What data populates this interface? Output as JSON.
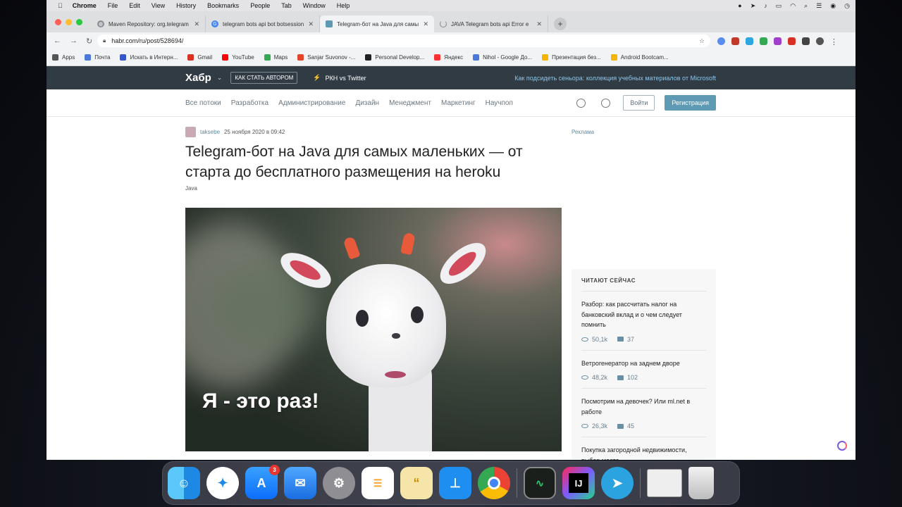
{
  "menubar": {
    "apple": "",
    "app": "Chrome",
    "items": [
      "File",
      "Edit",
      "View",
      "History",
      "Bookmarks",
      "People",
      "Tab",
      "Window",
      "Help"
    ]
  },
  "tabs": [
    {
      "title": "Maven Repository: org.telegram",
      "icon": "globe-icon"
    },
    {
      "title": "telegram bots api bot botsession",
      "icon": "google-icon"
    },
    {
      "title": "Telegram-бот на Java для самых",
      "icon": "habr-icon",
      "active": true
    },
    {
      "title": "JAVA Telegram bots api Error e",
      "icon": "loading-icon"
    }
  ],
  "toolbar": {
    "url": "habr.com/ru/post/528694/"
  },
  "bookmarks": [
    {
      "label": "Apps",
      "color": "#555"
    },
    {
      "label": "Почта",
      "color": "#4a79d9"
    },
    {
      "label": "Искать в Интерн...",
      "color": "#3558c9"
    },
    {
      "label": "Gmail",
      "color": "#d93025"
    },
    {
      "label": "YouTube",
      "color": "#ff0000"
    },
    {
      "label": "Maps",
      "color": "#34a853"
    },
    {
      "label": "Sanjar Suvonov -...",
      "color": "#e2432a"
    },
    {
      "label": "Personal Develop...",
      "color": "#222"
    },
    {
      "label": "Яндекс",
      "color": "#ff3333"
    },
    {
      "label": "Nihol - Google До...",
      "color": "#4a79d9"
    },
    {
      "label": "Презентация без...",
      "color": "#f4b400"
    },
    {
      "label": "Android Bootcam...",
      "color": "#f4b400"
    }
  ],
  "habr": {
    "logo": "Хабр",
    "become_author": "КАК СТАТЬ АВТОРОМ",
    "pkh": "РКН vs Twitter",
    "promo": "Как подсидеть сеньора: коллекция учебных материалов от Microsoft",
    "nav": [
      "Все потоки",
      "Разработка",
      "Администрирование",
      "Дизайн",
      "Менеджмент",
      "Маркетинг",
      "Научпоп"
    ],
    "login": "Войти",
    "register": "Регистрация"
  },
  "article": {
    "author": "taksebe",
    "date": "25 ноября 2020 в 09:42",
    "title": "Telegram-бот на Java для самых маленьких — от старта до бесплатного размещения на heroku",
    "tag": "Java",
    "image_caption": "Я - это раз!"
  },
  "sidebar": {
    "ad": "Реклама",
    "read_now_title": "ЧИТАЮТ СЕЙЧАС",
    "items": [
      {
        "title": "Разбор: как рассчитать налог на банковский вклад и о чем следует помнить",
        "views": "50,1k",
        "comments": "37"
      },
      {
        "title": "Ветрогенератор на заднем дворе",
        "views": "48,2k",
        "comments": "102"
      },
      {
        "title": "Посмотрим на девочек? Или ml.net в работе",
        "views": "26,3k",
        "comments": "45"
      },
      {
        "title": "Покупка загородной недвижимости, выбор места",
        "views": "",
        "comments": ""
      }
    ]
  },
  "dock": {
    "appstore_badge": "3",
    "intellij_label": "IJ"
  }
}
